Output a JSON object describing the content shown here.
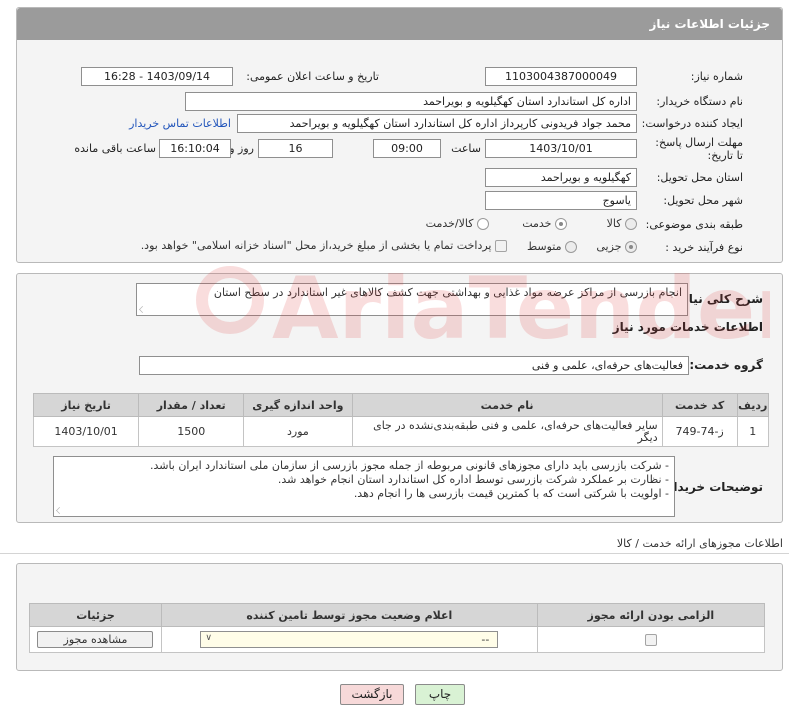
{
  "header": {
    "title": "جزئیات اطلاعات نیاز"
  },
  "need": {
    "number_label": "شماره نیاز:",
    "number": "1103004387000049",
    "announce_label": "تاریخ و ساعت اعلان عمومی:",
    "announce": "1403/09/14 - 16:28",
    "buyer_label": "نام دستگاه خریدار:",
    "buyer": "اداره کل استاندارد استان کهگیلویه و بویراحمد",
    "creator_label": "ایجاد کننده درخواست:",
    "creator": "محمد جواد  فریدونی کارپرداز اداره کل استاندارد استان کهگیلویه و بویراحمد",
    "contact_link": "اطلاعات تماس خریدار",
    "deadline_label": "مهلت ارسال پاسخ: تا تاریخ:",
    "deadline_date": "1403/10/01",
    "time_label": "ساعت",
    "deadline_time": "09:00",
    "days": "16",
    "days_label": "روز و",
    "remaining": "16:10:04",
    "remaining_label": "ساعت باقی مانده",
    "province_label": "استان محل تحویل:",
    "province": "کهگیلویه و بویراحمد",
    "city_label": "شهر محل تحویل:",
    "city": "یاسوج",
    "category_label": "طبقه بندی موضوعی:",
    "category_options": [
      "کالا",
      "خدمت",
      "کالا/خدمت"
    ],
    "category_selected": "خدمت",
    "process_label": "نوع فرآیند خرید :",
    "process_options": [
      "جزیی",
      "متوسط"
    ],
    "process_selected": "جزیی",
    "payment_note": "پرداخت تمام یا بخشی از مبلغ خرید،از محل \"اسناد خزانه اسلامی\" خواهد بود."
  },
  "summary": {
    "label": "شرح کلی نیاز:",
    "text": "انجام بازرسی از مراکز عرضه مواد غذایی و بهداشتی جهت کشف کالاهای غیر استاندارد در سطح استان"
  },
  "services": {
    "title": "اطلاعات خدمات مورد نیاز",
    "group_label": "گروه خدمت:",
    "group": "فعالیت‌های حرفه‌ای، علمی و فنی",
    "columns": [
      "ردیف",
      "کد خدمت",
      "نام خدمت",
      "واحد اندازه گیری",
      "تعداد / مقدار",
      "تاریخ نیاز"
    ],
    "rows": [
      {
        "row": "1",
        "code": "ز-74-749",
        "name": "سایر فعالیت‌های حرفه‌ای، علمی و فنی طبقه‌بندی‌نشده در جای دیگر",
        "unit": "مورد",
        "qty": "1500",
        "date": "1403/10/01"
      }
    ]
  },
  "notes": {
    "label": "توضیحات خریدار:",
    "lines": [
      "- شرکت بازرسی باید دارای مجوزهای قانونی مربوطه از جمله مجوز بازرسی از سازمان ملی استاندارد ایران باشد.",
      "- نظارت بر عملکرد شرکت بازرسی توسط اداره کل استاندارد استان انجام خواهد شد.",
      "- اولویت با شرکتی است که با کمترین قیمت بازرسی ها را انجام دهد."
    ]
  },
  "permits": {
    "title": "اطلاعات مجوزهای ارائه خدمت / کالا",
    "columns": [
      "الزامی بودن ارائه مجوز",
      "اعلام وضعیت مجوز توسط تامین کننده",
      "جزئیات"
    ],
    "select_value": "--",
    "view_button": "مشاهده مجوز"
  },
  "actions": {
    "print": "چاپ",
    "back": "بازگشت"
  },
  "watermark": {
    "text": "AriaTender.neT"
  },
  "colors": {
    "header": "#9b9b9b",
    "link": "#2255bb",
    "back_button": "#f7d9d9",
    "print_button": "#d9f2d4",
    "watermark": "#d33"
  }
}
